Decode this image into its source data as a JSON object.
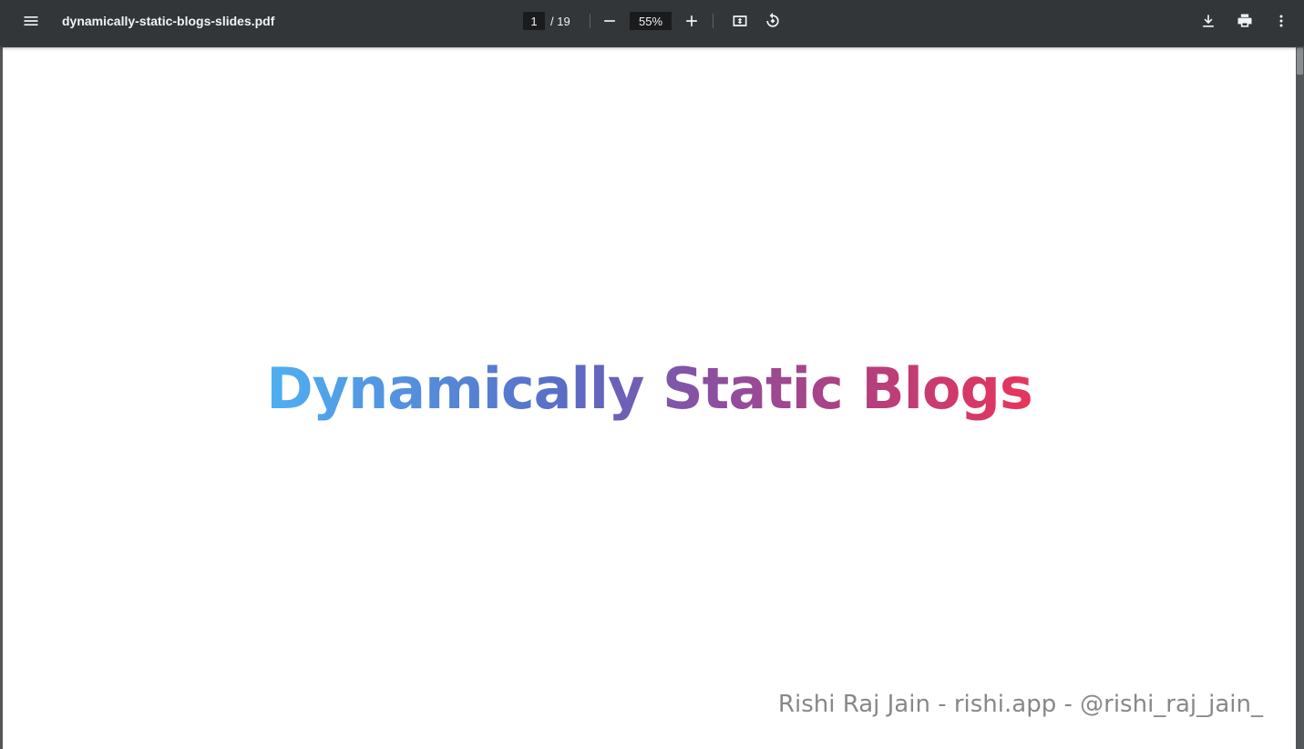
{
  "toolbar": {
    "menu_icon": "menu-icon",
    "title": "dynamically-static-blogs-slides.pdf",
    "page_current": "1",
    "page_total": "/ 19",
    "zoom_out_icon": "minus-icon",
    "zoom_level": "55%",
    "zoom_in_icon": "plus-icon",
    "fit_icon": "fit-to-page-icon",
    "rotate_icon": "rotate-icon",
    "download_icon": "download-icon",
    "print_icon": "print-icon",
    "more_icon": "more-vert-icon"
  },
  "slide": {
    "title": "Dynamically Static Blogs",
    "footer": "Rishi Raj Jain - rishi.app - @rishi_raj_jain_"
  },
  "colors": {
    "toolbar_bg": "#323639",
    "viewer_bg": "#525659",
    "gradient_start": "#4eb0f2",
    "gradient_end": "#e8355a"
  }
}
